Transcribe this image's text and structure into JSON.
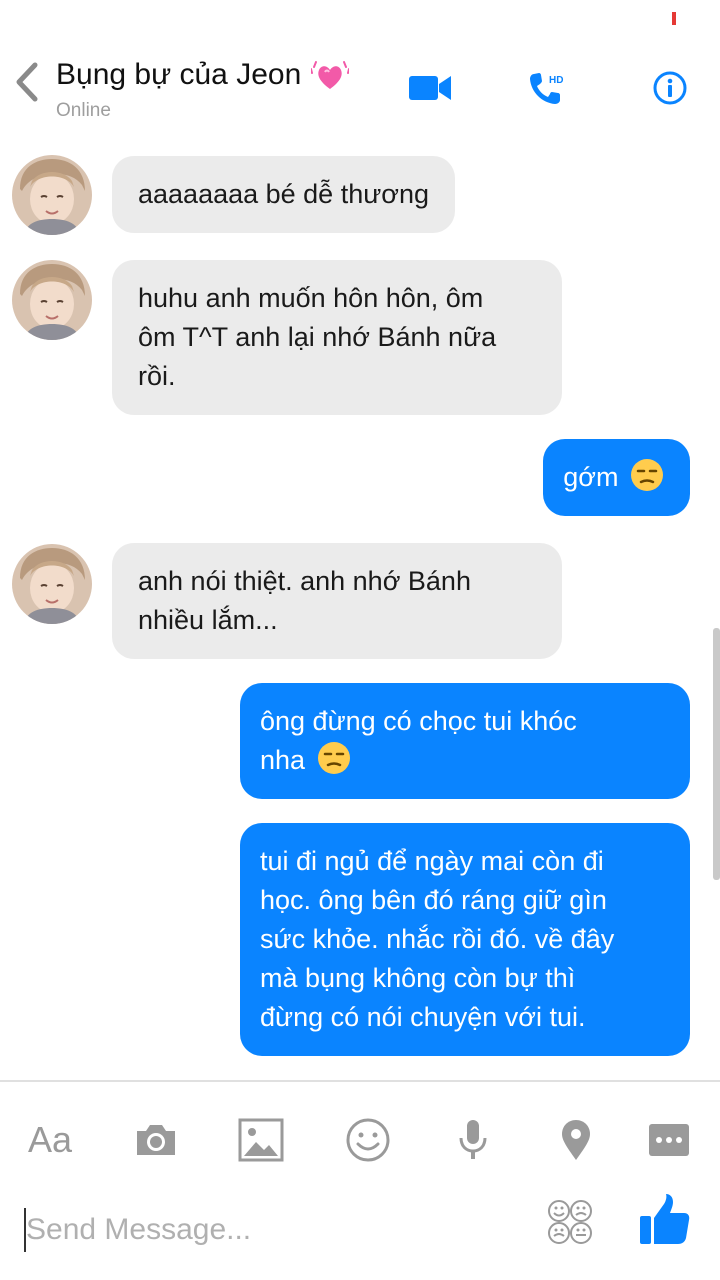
{
  "colors": {
    "accent": "#0a84ff",
    "incoming_bubble": "#ebebeb",
    "muted": "#9e9e9e"
  },
  "header": {
    "title": "Bụng bự của Jeon",
    "title_emoji": "sparkling-heart",
    "status": "Online",
    "icons": [
      "back-chevron-icon",
      "video-camera-icon",
      "hd-call-icon",
      "info-icon"
    ]
  },
  "messages": [
    {
      "direction": "in",
      "text": "aaaaaaaa bé dễ thương"
    },
    {
      "direction": "in",
      "lines": [
        "huhu anh muốn hôn hôn, ôm",
        "ôm T^T anh lại nhớ Bánh nữa",
        "rồi."
      ]
    },
    {
      "direction": "out",
      "text": "gớm",
      "emoji": "unamused-face"
    },
    {
      "direction": "in",
      "lines": [
        "anh nói thiệt. anh nhớ Bánh",
        "nhiều lắm..."
      ]
    },
    {
      "direction": "out",
      "lines": [
        "ông đừng có chọc tui khóc",
        "nha"
      ],
      "emoji": "unamused-face"
    },
    {
      "direction": "out",
      "lines": [
        "tui đi ngủ để ngày mai còn đi",
        "học. ông bên đó ráng giữ gìn",
        "sức khỏe. nhắc rồi đó. về đây",
        "mà bụng không còn bự thì",
        "đừng có nói chuyện với tui."
      ]
    }
  ],
  "toolbar": {
    "text_label": "Aa",
    "icons": [
      "camera-icon",
      "gallery-icon",
      "emoji-icon",
      "microphone-icon",
      "location-pin-icon",
      "more-icon"
    ]
  },
  "composer": {
    "placeholder": "Send Message...",
    "value": "",
    "icons": [
      "sticker-faces-icon",
      "thumbs-up-icon"
    ]
  }
}
